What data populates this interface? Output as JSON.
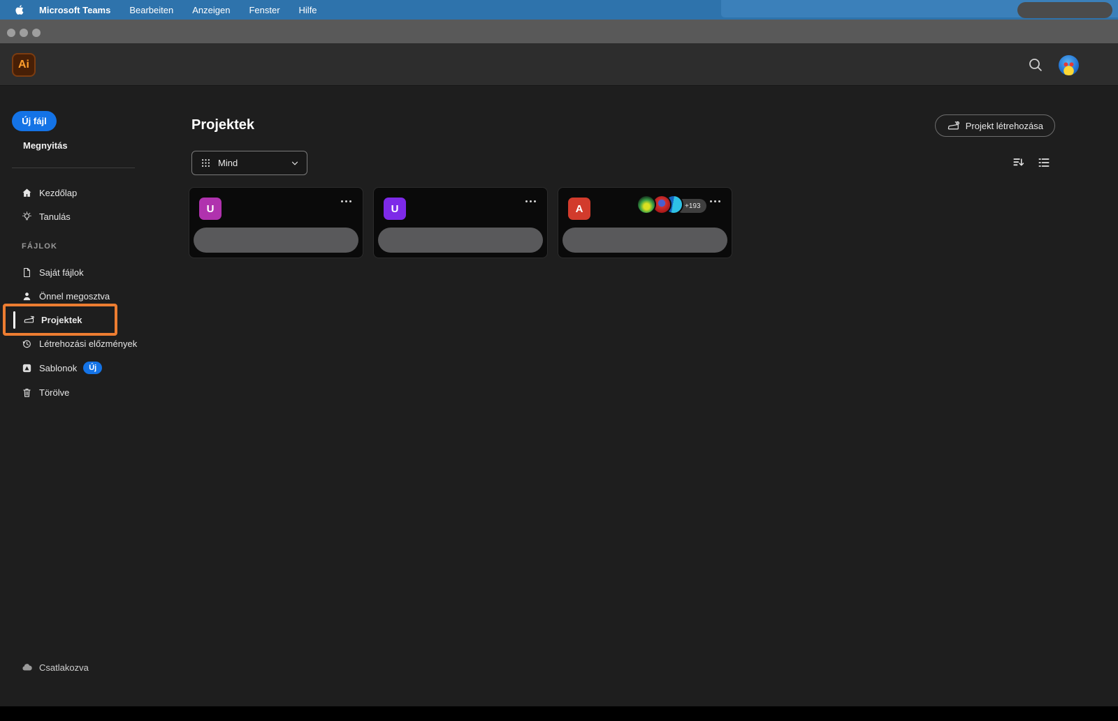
{
  "menubar": {
    "app_name": "Microsoft Teams",
    "items": [
      "Bearbeiten",
      "Anzeigen",
      "Fenster",
      "Hilfe"
    ]
  },
  "header": {
    "logo_text": "Ai"
  },
  "sidebar": {
    "new_file_button": "Új fájl",
    "open_label": "Megnyitás",
    "nav_top": [
      {
        "label": "Kezdőlap"
      },
      {
        "label": "Tanulás"
      }
    ],
    "section_label": "FÁJLOK",
    "nav_files": [
      {
        "label": "Saját fájlok"
      },
      {
        "label": "Önnel megosztva"
      },
      {
        "label": "Projektek"
      },
      {
        "label": "Létrehozási előzmények"
      },
      {
        "label": "Sablonok",
        "badge": "Új"
      },
      {
        "label": "Törölve"
      }
    ],
    "status_label": "Csatlakozva"
  },
  "main": {
    "title": "Projektek",
    "filter": {
      "selected": "Mind"
    },
    "create_button_label": "Projekt létrehozása",
    "cards": [
      {
        "initial": "U",
        "tile_style": "background:#b032ae"
      },
      {
        "initial": "U",
        "tile_style": "background:#7d2ae8"
      },
      {
        "initial": "A",
        "tile_style": "background:#d23b2c",
        "overflow_count": "+193"
      }
    ]
  },
  "colors": {
    "menubar_blue": "#2e73ac",
    "accent_blue": "#1473e6",
    "annotation_orange": "#ed7d31",
    "background_dark": "#1e1e1e"
  }
}
